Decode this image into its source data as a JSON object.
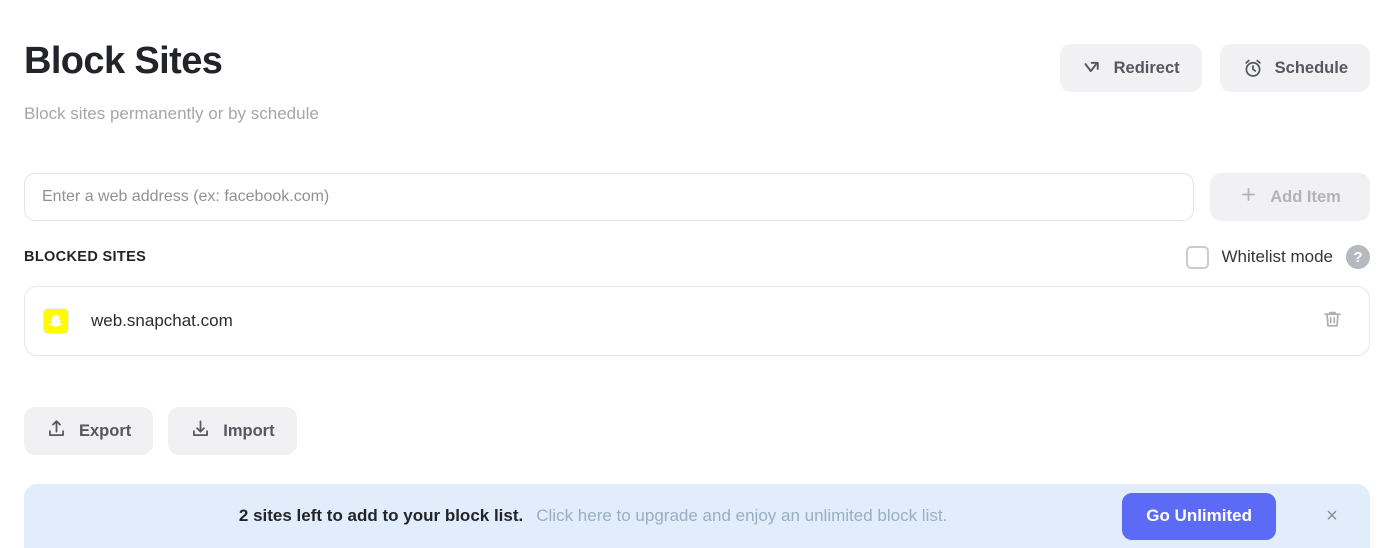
{
  "header": {
    "title": "Block Sites",
    "subtitle": "Block sites permanently or by schedule",
    "actions": [
      {
        "label": "Redirect",
        "icon": "redirect-arrow-icon"
      },
      {
        "label": "Schedule",
        "icon": "alarm-clock-icon"
      }
    ]
  },
  "add_row": {
    "input_placeholder": "Enter a web address (ex: facebook.com)",
    "input_value": "",
    "add_button_label": "Add Item",
    "add_button_icon": "plus-icon",
    "add_button_disabled": true
  },
  "list_header": {
    "section_label": "BLOCKED SITES",
    "whitelist_label": "Whitelist mode",
    "whitelist_checked": false,
    "help_glyph": "?"
  },
  "blocked_sites": [
    {
      "name": "web.snapchat.com",
      "favicon": "snapchat-ghost-icon",
      "favicon_color": "#FFFC00",
      "delete_icon": "trash-icon"
    }
  ],
  "io_buttons": [
    {
      "label": "Export",
      "icon": "upload-icon"
    },
    {
      "label": "Import",
      "icon": "download-icon"
    }
  ],
  "banner": {
    "message": "2 sites left to add to your block list.",
    "submessage": "Click here to upgrade and enjoy an unlimited block list.",
    "cta_label": "Go Unlimited",
    "close_glyph": "×",
    "background_color": "#e2edfb",
    "cta_color": "#5b6bf5"
  }
}
